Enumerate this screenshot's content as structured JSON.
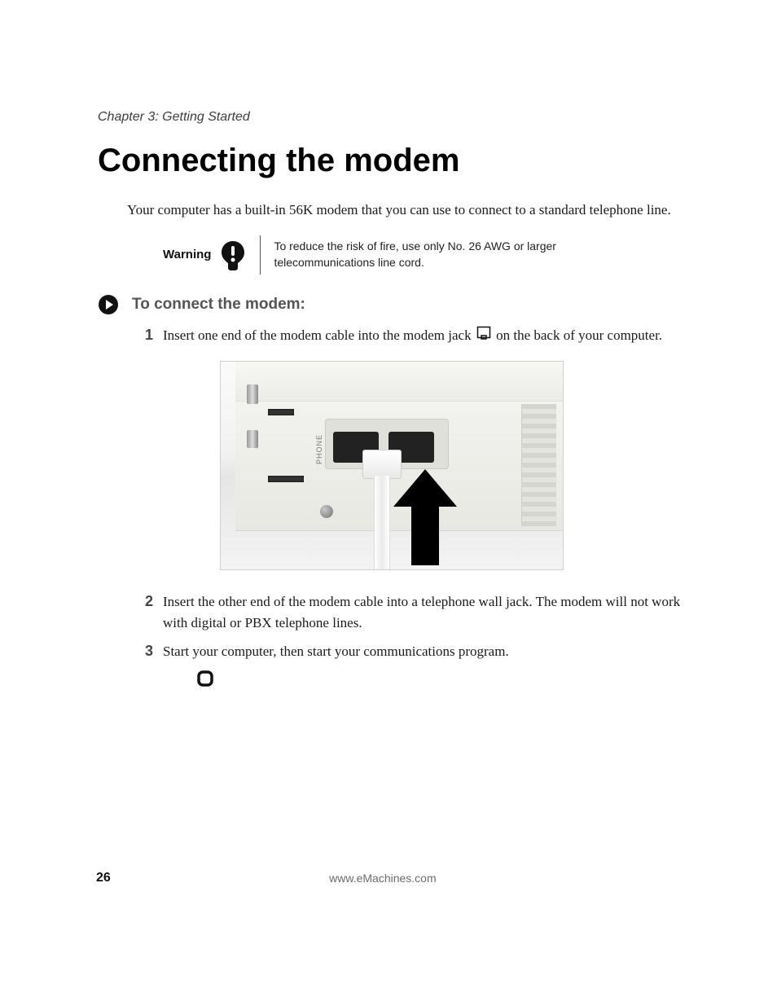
{
  "chapter_header": "Chapter 3: Getting Started",
  "page_title": "Connecting the modem",
  "intro": "Your computer has a built-in 56K modem that you can use to connect to a standard telephone line.",
  "warning": {
    "label": "Warning",
    "text": "To reduce the risk of fire, use only No. 26 AWG or larger telecommunications line cord."
  },
  "procedure_heading": "To connect the modem:",
  "steps": {
    "s1_pre": "Insert one end of the modem cable into the modem jack ",
    "s1_post": " on the back of your computer.",
    "s2": "Insert the other end of the modem cable into a telephone wall jack. The modem will not work with digital or PBX telephone lines.",
    "s3": "Start your computer, then start your communications program.",
    "n1": "1",
    "n2": "2",
    "n3": "3"
  },
  "figure": {
    "eth_label": "PHONE"
  },
  "footer": {
    "page_number": "26",
    "url": "www.eMachines.com"
  }
}
